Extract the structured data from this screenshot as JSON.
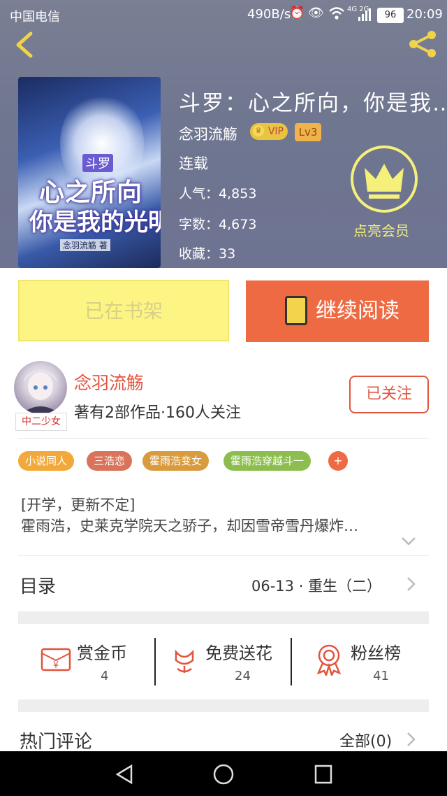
{
  "status_bar": {
    "carrier": "中国电信",
    "speed": "490B/s",
    "network": "4G 2G",
    "battery": "96",
    "time": "20:09"
  },
  "book": {
    "title": "斗罗：心之所向，你是我…",
    "author": "念羽流觞",
    "vip_label": "VIP",
    "level": "Lv3",
    "status": "连载",
    "popularity_label": "人气：",
    "popularity": "4,853",
    "words_label": "字数：",
    "words": "4,673",
    "favorites_label": "收藏：",
    "favorites": "33",
    "member_label": "点亮会员",
    "cover": {
      "line1": "斗罗",
      "line2": "心之所向",
      "line3": "你是我的光明",
      "line4": "念羽流觞 著"
    }
  },
  "actions": {
    "shelf_label": "已在书架",
    "read_label": "继续阅读"
  },
  "author_card": {
    "name": "念羽流觞",
    "info": "著有2部作品·160人关注",
    "badge": "中二少女",
    "follow_label": "已关注"
  },
  "tags": [
    {
      "label": "小说同人",
      "color": "#f2a93b"
    },
    {
      "label": "三浩恋",
      "color": "#d9735a"
    },
    {
      "label": "霍雨浩变女",
      "color": "#d99b3e"
    },
    {
      "label": "霍雨浩穿越斗一",
      "color": "#8cbd4e"
    }
  ],
  "tag_more": "+",
  "description": {
    "line1": "[开学，更新不定]",
    "line2": "霍雨浩，史莱克学院天之骄子，却因雪帝雪丹爆炸…"
  },
  "toc": {
    "label": "目录",
    "latest": "06-13 · 重生（二）"
  },
  "rewards": [
    {
      "label": "赏金币",
      "value": "4",
      "icon": "red-envelope-icon"
    },
    {
      "label": "免费送花",
      "value": "24",
      "icon": "flower-icon"
    },
    {
      "label": "粉丝榜",
      "value": "41",
      "icon": "award-ribbon-icon"
    }
  ],
  "comments": {
    "label": "热门评论",
    "all": "全部(0)"
  },
  "colors": {
    "accent": "#ee6a43",
    "brand_red": "#e2543e",
    "shelf_yellow": "#fdf583",
    "member_yellow": "#f5f07a"
  }
}
